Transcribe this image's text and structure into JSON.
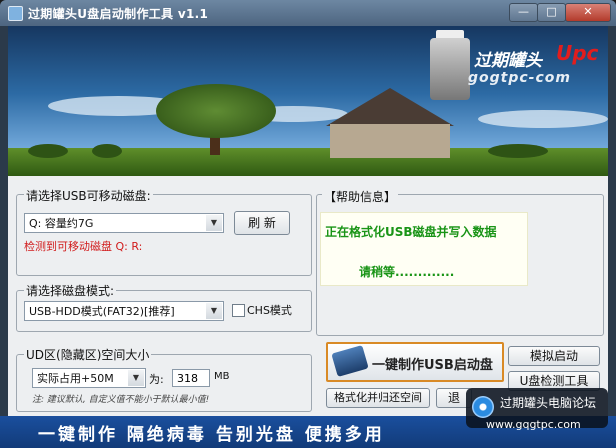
{
  "window": {
    "title": "过期罐头U盘启动制作工具 v1.1",
    "minimize_glyph": "—",
    "maximize_glyph": "□",
    "close_glyph": "✕"
  },
  "banner": {
    "brand_name": "过期罐头",
    "brand_upc": "Upc",
    "brand_url": "gogtpc-com"
  },
  "usb_disk": {
    "label": "请选择USB可移动磁盘:",
    "selected": "Q:   容量约7G",
    "refresh_label": "刷 新",
    "detected": "检测到可移动磁盘  Q: R:"
  },
  "mode": {
    "label": "请选择磁盘模式:",
    "selected": "USB-HDD模式(FAT32)[推荐]",
    "chs_label": "CHS模式"
  },
  "udisk_area": {
    "label": "UD区(隐藏区)空间大小",
    "selected": "实际占用+50M",
    "size_prefix": "为:",
    "size_value": "318",
    "size_unit": "MB",
    "note": "注: 建议默认, 自定义值不能小于默认最小值!"
  },
  "help": {
    "title": "【帮助信息】",
    "line1": "正在格式化USB磁盘并写入数据",
    "line2": "请稍等.............",
    "colors": {
      "text": "#199416",
      "bg": "#fffff4"
    }
  },
  "actions": {
    "make_label": "一键制作USB启动盘",
    "simulate_label": "模拟启动",
    "udisk_check_label": "U盘检测工具",
    "format_restore_label": "格式化并归还空间",
    "exit_label": "退"
  },
  "footer": {
    "slogan": "一键制作  隔绝病毒  告别光盘  便携多用"
  },
  "watermark": {
    "name": "过期罐头电脑论坛",
    "url": "www.gqgtpc.com"
  },
  "icons": {
    "app": "app-icon",
    "usb": "usb-drive-icon",
    "dropdown": "chevron-down-icon"
  },
  "colors": {
    "title_bar": "#5a728c",
    "footer": "#1a4f9e",
    "close_button": "#c4463a",
    "warning_text": "#d11b1b",
    "make_button_border": "#d98a26"
  }
}
